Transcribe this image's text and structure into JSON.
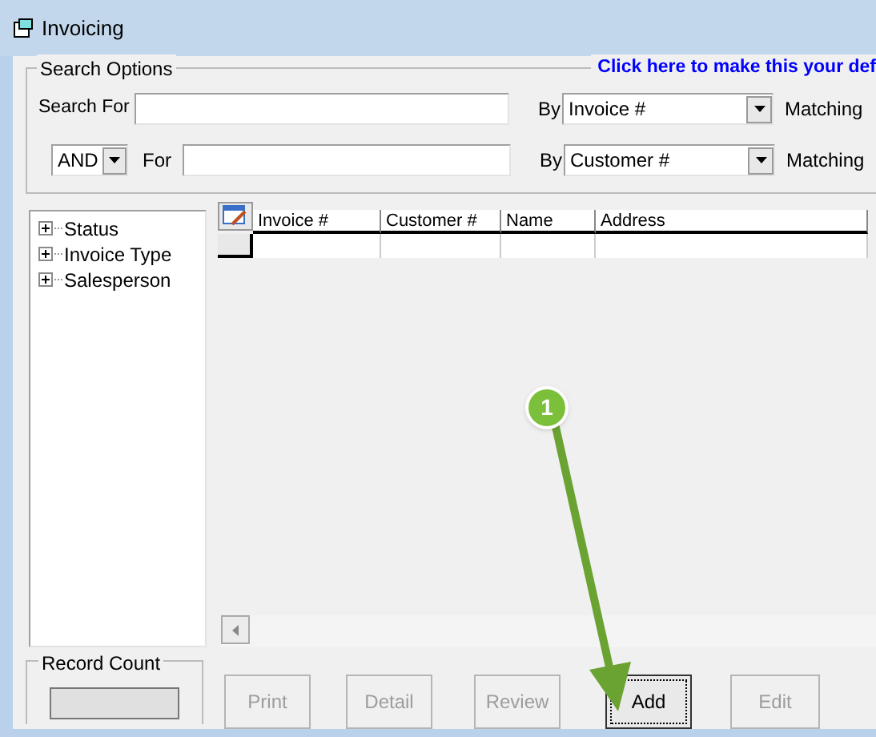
{
  "window": {
    "title": "Invoicing"
  },
  "search_options": {
    "title": "Search Options",
    "default_link": "Click here to make this your def",
    "rows": [
      {
        "kind": "first",
        "label": "Search For",
        "by_label": "By",
        "by_value": "Invoice #",
        "matching_label": "Matching"
      },
      {
        "kind": "joined",
        "connector": "AND",
        "label": "For",
        "by_label": "By",
        "by_value": "Customer #",
        "matching_label": "Matching"
      }
    ]
  },
  "tree": {
    "items": [
      {
        "label": "Status",
        "expanded": false
      },
      {
        "label": "Invoice Type",
        "expanded": false
      },
      {
        "label": "Salesperson",
        "expanded": false
      }
    ]
  },
  "grid": {
    "columns": [
      "Invoice #",
      "Customer #",
      "Name",
      "Address"
    ]
  },
  "record_count": {
    "title": "Record Count"
  },
  "buttons": [
    {
      "label": "Print",
      "disabled": true,
      "focused": false
    },
    {
      "label": "Detail",
      "disabled": true,
      "focused": false
    },
    {
      "label": "Review",
      "disabled": true,
      "focused": false
    },
    {
      "label": "Add",
      "disabled": false,
      "focused": true
    },
    {
      "label": "Edit",
      "disabled": true,
      "focused": false
    }
  ],
  "annotation": {
    "number": "1"
  }
}
